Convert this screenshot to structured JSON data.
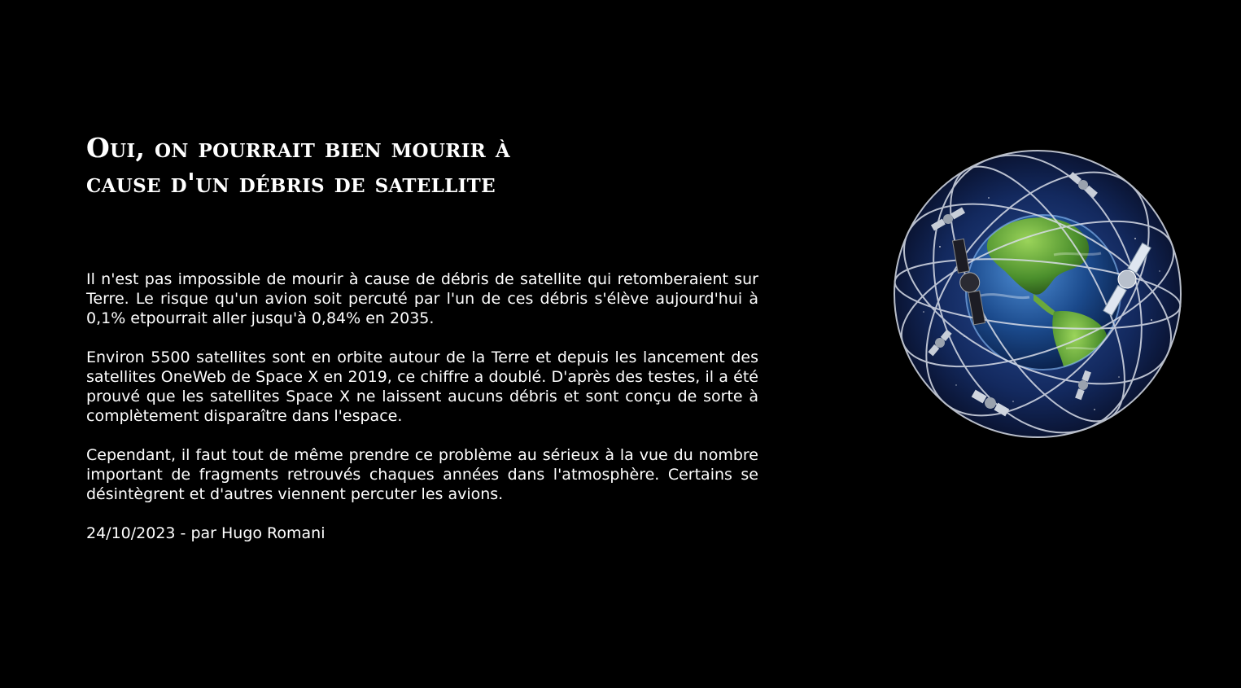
{
  "article": {
    "title_line1": "Oui, on pourrait bien mourir à",
    "title_line2": "cause d'un débris de satellite",
    "paragraphs": [
      "Il n'est pas impossible de mourir à cause de débris de satellite qui retomberaient sur Terre. Le risque qu'un avion soit percuté par l'un de ces débris s'élève aujourd'hui à 0,1% etpourrait aller jusqu'à 0,84% en 2035.",
      "Environ 5500 satellites sont en orbite autour de la Terre et depuis les lancement des satellites OneWeb de Space X en 2019, ce chiffre a doublé. D'après des testes, il a été prouvé que les satellites Space X ne laissent aucuns débris et sont conçu de sorte à complètement disparaître dans l'espace.",
      "Cependant, il faut tout de même prendre ce problème au sérieux à la vue du nombre important de fragments retrouvés chaques années dans l'atmosphère. Certains se désintègrent et d'autres viennent percuter les avions."
    ],
    "byline": "24/10/2023 - par Hugo Romani"
  },
  "illustration": {
    "subject": "earth-with-satellite-orbits",
    "colors": {
      "background": "#000000",
      "text": "#ffffff",
      "ocean": "#1b4a8c",
      "land": "#5fa83a",
      "orbit": "#d8dde8"
    }
  }
}
